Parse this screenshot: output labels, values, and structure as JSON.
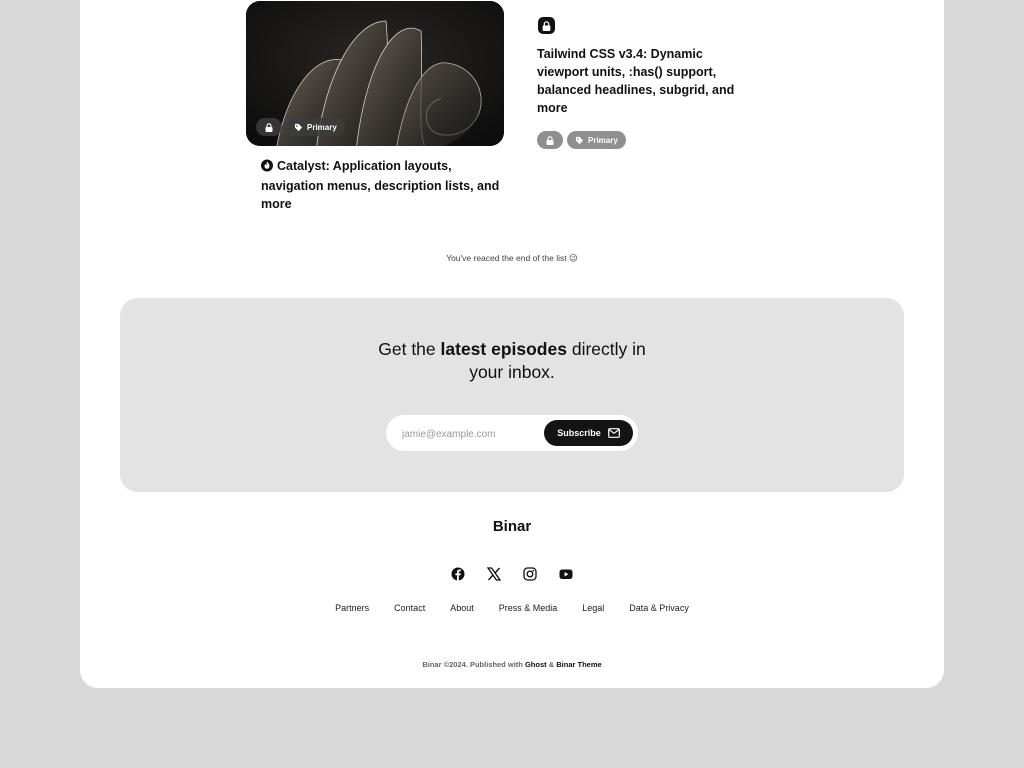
{
  "posts": [
    {
      "title": "Catalyst: Application layouts, navigation menus, description lists, and more",
      "tag": "Primary",
      "featured_icon": "fire-icon",
      "locked_icon": "lock-icon"
    },
    {
      "title": "Tailwind CSS v3.4: Dynamic viewport units, :has() support, balanced headlines, subgrid, and more",
      "tag": "Primary",
      "locked_icon": "lock-icon"
    }
  ],
  "end_note": "You've reaced the end of the list 😉",
  "newsletter": {
    "heading_pre": "Get the ",
    "heading_bold": "latest episodes",
    "heading_post": " directly in",
    "heading_line2": "your inbox.",
    "email_placeholder": "jamie@example.com",
    "subscribe_label": "Subscribe"
  },
  "footer": {
    "brand": "Binar",
    "social_icons": [
      "facebook-icon",
      "x-icon",
      "instagram-icon",
      "youtube-icon"
    ],
    "links": [
      "Partners",
      "Contact",
      "About",
      "Press & Media",
      "Legal",
      "Data & Privacy"
    ],
    "copyright_pre": "Binar ©2024. Published with ",
    "copyright_ghost": "Ghost",
    "copyright_amp": " & ",
    "copyright_theme": "Binar Theme"
  },
  "colors": {
    "page_background": "#d9d9d9",
    "card_background": "#ffffff",
    "newsletter_background": "#e3e3e3",
    "button_background": "#141414",
    "tag_grey": "#8f8f8f"
  }
}
